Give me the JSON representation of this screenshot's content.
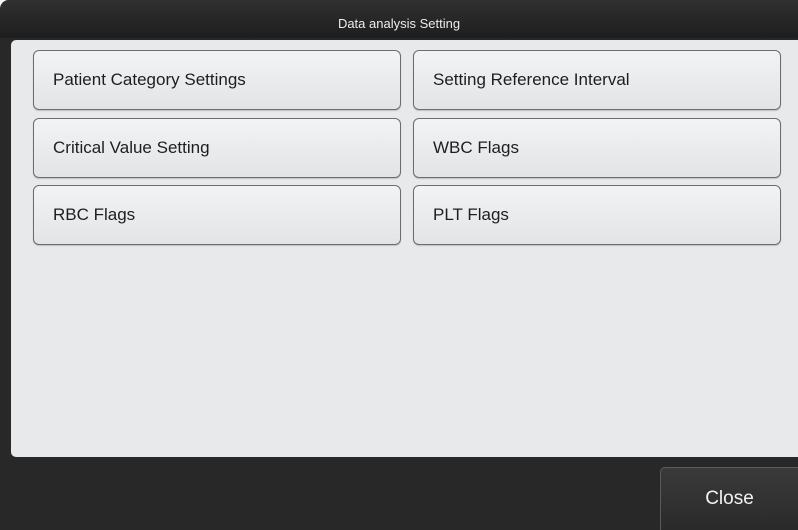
{
  "dialog": {
    "title": "Data analysis Setting"
  },
  "settings": {
    "buttons": [
      {
        "label": "Patient Category Settings"
      },
      {
        "label": "Setting Reference Interval"
      },
      {
        "label": "Critical Value Setting"
      },
      {
        "label": "WBC Flags"
      },
      {
        "label": "RBC Flags"
      },
      {
        "label": "PLT Flags"
      }
    ]
  },
  "footer": {
    "close_label": "Close"
  }
}
